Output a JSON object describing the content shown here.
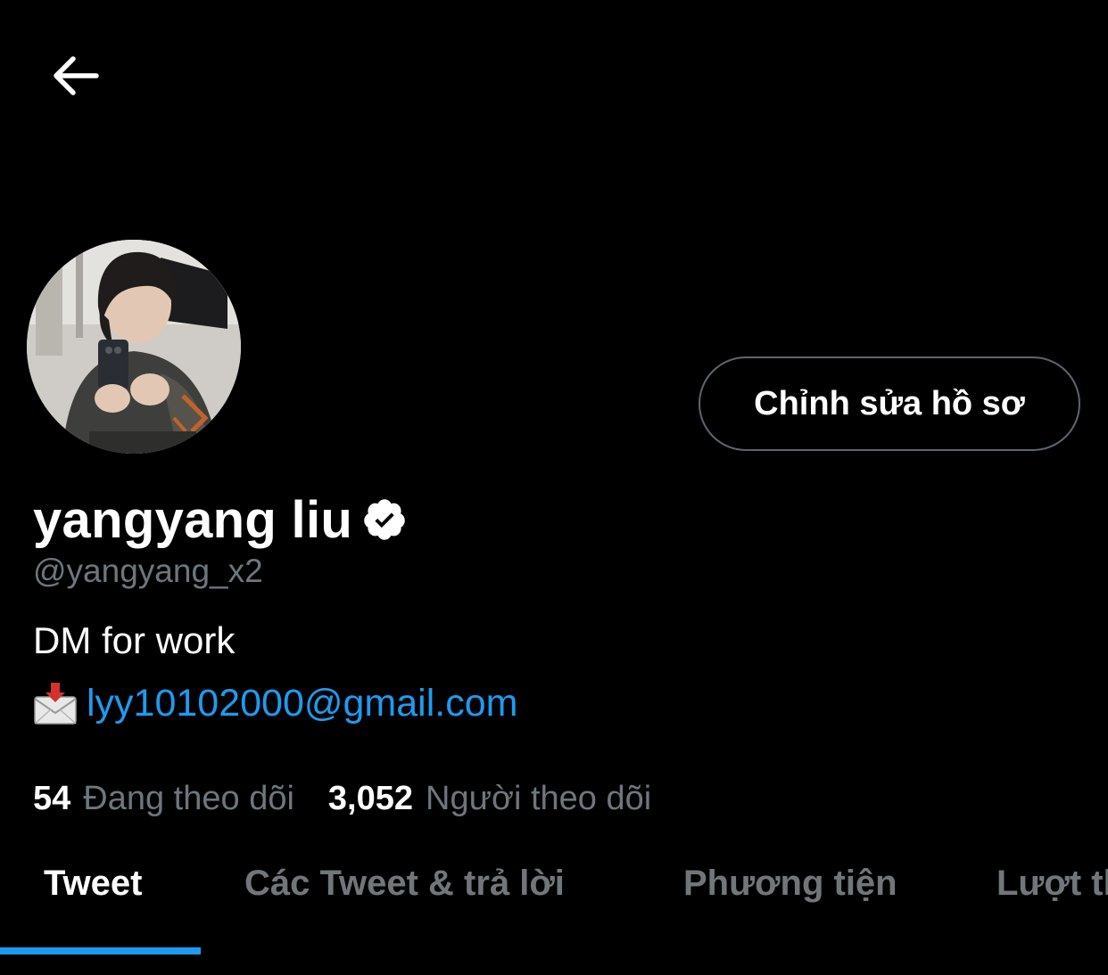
{
  "colors": {
    "background": "#000000",
    "accent": "#1d9bf0",
    "text_primary": "#ffffff",
    "text_secondary": "#6e767d"
  },
  "header": {
    "back_icon": "arrow-left-icon"
  },
  "profile": {
    "avatar_icon": "profile-photo",
    "edit_button_label": "Chỉnh sửa hồ sơ",
    "display_name": "yangyang liu",
    "verified_icon": "verified-badge-icon",
    "handle": "@yangyang_x2",
    "bio_line": "DM for work",
    "email_icon": "inbox-tray-envelope-icon",
    "email": "lyy10102000@gmail.com"
  },
  "stats": {
    "following_count": "54",
    "following_label": "Đang theo dõi",
    "followers_count": "3,052",
    "followers_label": "Người theo dõi"
  },
  "tabs": [
    {
      "label": "Tweet",
      "active": true
    },
    {
      "label": "Các Tweet & trả lời",
      "active": false
    },
    {
      "label": "Phương tiện",
      "active": false
    },
    {
      "label": "Lượt thích",
      "active": false
    }
  ]
}
